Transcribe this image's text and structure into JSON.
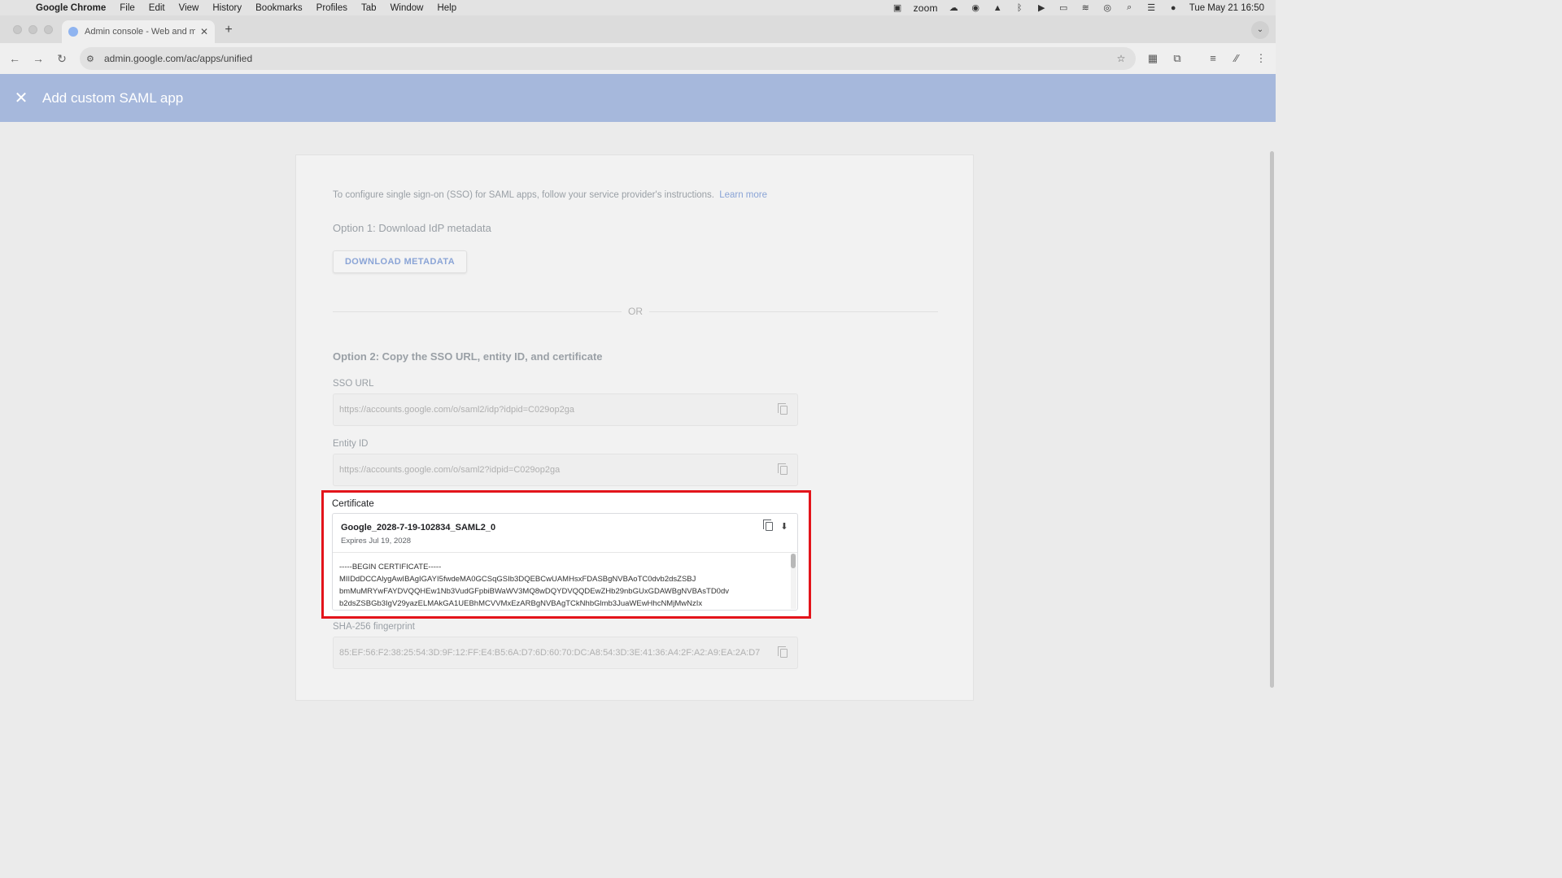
{
  "menubar": {
    "app": "Google Chrome",
    "items": [
      "File",
      "Edit",
      "View",
      "History",
      "Bookmarks",
      "Profiles",
      "Tab",
      "Window",
      "Help"
    ],
    "zoom_label": "zoom",
    "datetime": "Tue May 21  16:50"
  },
  "browser": {
    "tab_title": "Admin console - Web and mo",
    "url": "admin.google.com/ac/apps/unified"
  },
  "appbar": {
    "title": "Add custom SAML app"
  },
  "content": {
    "intro": "To configure single sign-on (SSO) for SAML apps, follow your service provider's instructions.",
    "learn_more": "Learn more",
    "option1_heading": "Option 1: Download IdP metadata",
    "download_button": "DOWNLOAD METADATA",
    "or_label": "OR",
    "option2_heading": "Option 2: Copy the SSO URL, entity ID, and certificate",
    "sso_url_label": "SSO URL",
    "sso_url_value": "https://accounts.google.com/o/saml2/idp?idpid=C029op2ga",
    "entity_id_label": "Entity ID",
    "entity_id_value": "https://accounts.google.com/o/saml2?idpid=C029op2ga",
    "certificate_label": "Certificate",
    "certificate_name": "Google_2028-7-19-102834_SAML2_0",
    "certificate_expires": "Expires Jul 19, 2028",
    "certificate_lines": [
      "-----BEGIN CERTIFICATE-----",
      "MIIDdDCCAlygAwIBAgIGAYI5fwdeMA0GCSqGSIb3DQEBCwUAMHsxFDASBgNVBAoTC0dvb2dsZSBJ",
      "bmMuMRYwFAYDVQQHEw1Nb3VudGFpbiBWaWV3MQ8wDQYDVQQDEwZHb29nbGUxGDAWBgNVBAsTD0dv",
      "b2dsZSBGb3IgV29yazELMAkGA1UEBhMCVVMxEzARBgNVBAgTCkNhbGlmb3JuaWEwHhcNMjMwNzIx"
    ],
    "fingerprint_label": "SHA-256 fingerprint",
    "fingerprint_value": "85:EF:56:F2:38:25:54:3D:9F:12:FF:E4:B5:6A:D7:6D:60:70:DC:A8:54:3D:3E:41:36:A4:2F:A2:A9:EA:2A:D7"
  },
  "colors": {
    "appbar": "#a6b8dc",
    "highlight": "#e3141b",
    "link": "#8aa4d6"
  }
}
